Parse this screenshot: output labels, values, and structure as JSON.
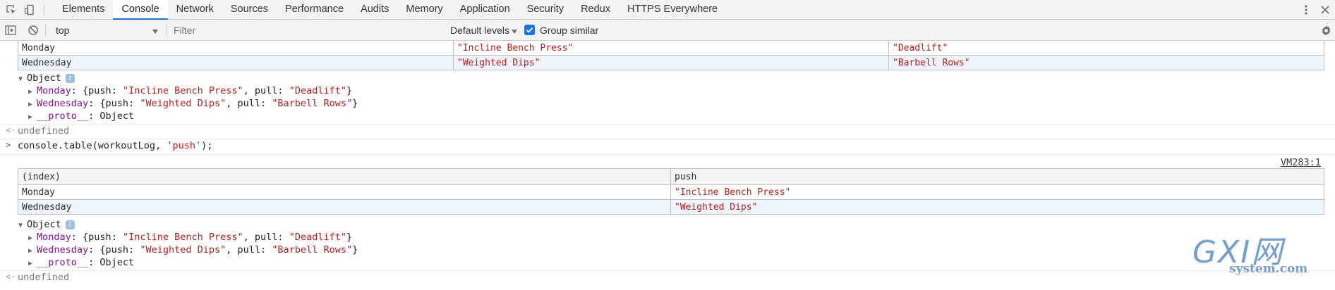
{
  "tabbar": {
    "tabs": [
      {
        "label": "Elements"
      },
      {
        "label": "Console",
        "active": true
      },
      {
        "label": "Network"
      },
      {
        "label": "Sources"
      },
      {
        "label": "Performance"
      },
      {
        "label": "Audits"
      },
      {
        "label": "Memory"
      },
      {
        "label": "Application"
      },
      {
        "label": "Security"
      },
      {
        "label": "Redux"
      },
      {
        "label": "HTTPS Everywhere"
      }
    ],
    "accent": "#1a73e8"
  },
  "toolbar": {
    "context": "top",
    "filter_placeholder": "Filter",
    "levels": "Default levels",
    "group_similar": "Group similar"
  },
  "console": {
    "table1": {
      "rows": [
        {
          "index": "Monday",
          "push": "\"Incline Bench Press\"",
          "pull": "\"Deadlift\""
        },
        {
          "index": "Wednesday",
          "push": "\"Weighted Dips\"",
          "pull": "\"Barbell Rows\""
        }
      ]
    },
    "object1": {
      "label": "Object",
      "entries": [
        {
          "key": "Monday",
          "push": "\"Incline Bench Press\"",
          "pull": "\"Deadlift\""
        },
        {
          "key": "Wednesday",
          "push": "\"Weighted Dips\"",
          "pull": "\"Barbell Rows\""
        }
      ],
      "proto_key": "__proto__",
      "proto_value": "Object"
    },
    "result1": "undefined",
    "input": {
      "fn": "console.table(workoutLog, ",
      "arg": "'push'",
      "end": ");"
    },
    "source_link": "VM283:1",
    "table2": {
      "header": [
        "(index)",
        "push"
      ],
      "rows": [
        {
          "index": "Monday",
          "push": "\"Incline Bench Press\""
        },
        {
          "index": "Wednesday",
          "push": "\"Weighted Dips\""
        }
      ]
    },
    "object2": {
      "label": "Object",
      "entries": [
        {
          "key": "Monday",
          "push": "\"Incline Bench Press\"",
          "pull": "\"Deadlift\""
        },
        {
          "key": "Wednesday",
          "push": "\"Weighted Dips\"",
          "pull": "\"Barbell Rows\""
        }
      ],
      "proto_key": "__proto__",
      "proto_value": "Object"
    },
    "result2": "undefined",
    "syntax": {
      "push_label": "push",
      "pull_label": "pull"
    }
  },
  "watermark": {
    "big": "GXI网",
    "small": "system.com"
  }
}
